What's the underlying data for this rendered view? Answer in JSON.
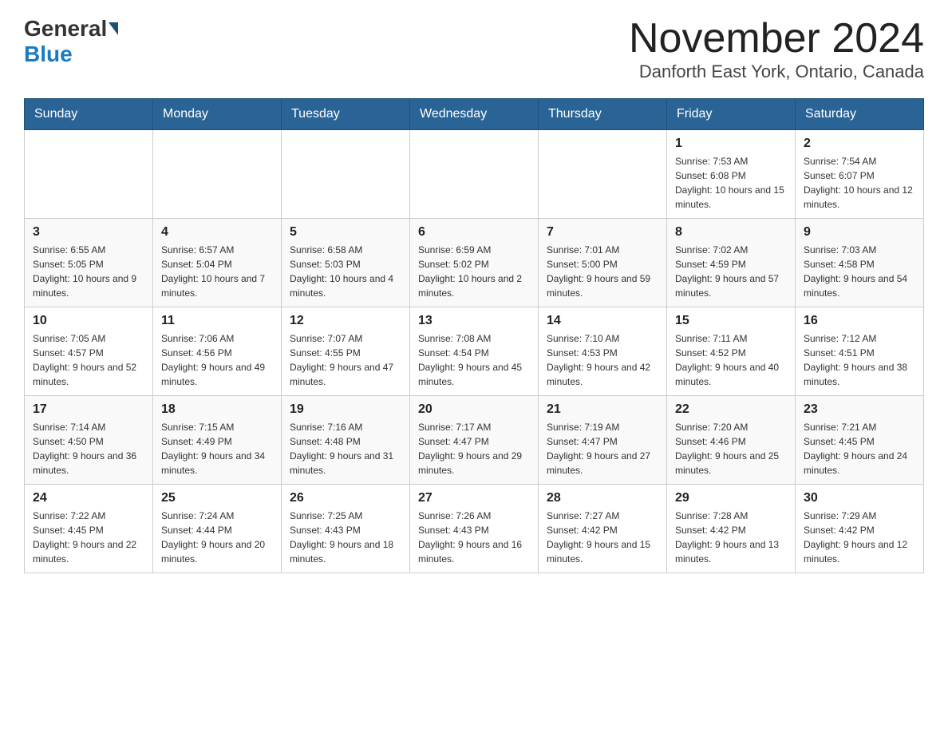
{
  "header": {
    "logo_general": "General",
    "logo_blue": "Blue",
    "month_title": "November 2024",
    "location": "Danforth East York, Ontario, Canada"
  },
  "columns": [
    "Sunday",
    "Monday",
    "Tuesday",
    "Wednesday",
    "Thursday",
    "Friday",
    "Saturday"
  ],
  "weeks": [
    {
      "days": [
        {
          "num": "",
          "info": ""
        },
        {
          "num": "",
          "info": ""
        },
        {
          "num": "",
          "info": ""
        },
        {
          "num": "",
          "info": ""
        },
        {
          "num": "",
          "info": ""
        },
        {
          "num": "1",
          "info": "Sunrise: 7:53 AM\nSunset: 6:08 PM\nDaylight: 10 hours and 15 minutes."
        },
        {
          "num": "2",
          "info": "Sunrise: 7:54 AM\nSunset: 6:07 PM\nDaylight: 10 hours and 12 minutes."
        }
      ]
    },
    {
      "days": [
        {
          "num": "3",
          "info": "Sunrise: 6:55 AM\nSunset: 5:05 PM\nDaylight: 10 hours and 9 minutes."
        },
        {
          "num": "4",
          "info": "Sunrise: 6:57 AM\nSunset: 5:04 PM\nDaylight: 10 hours and 7 minutes."
        },
        {
          "num": "5",
          "info": "Sunrise: 6:58 AM\nSunset: 5:03 PM\nDaylight: 10 hours and 4 minutes."
        },
        {
          "num": "6",
          "info": "Sunrise: 6:59 AM\nSunset: 5:02 PM\nDaylight: 10 hours and 2 minutes."
        },
        {
          "num": "7",
          "info": "Sunrise: 7:01 AM\nSunset: 5:00 PM\nDaylight: 9 hours and 59 minutes."
        },
        {
          "num": "8",
          "info": "Sunrise: 7:02 AM\nSunset: 4:59 PM\nDaylight: 9 hours and 57 minutes."
        },
        {
          "num": "9",
          "info": "Sunrise: 7:03 AM\nSunset: 4:58 PM\nDaylight: 9 hours and 54 minutes."
        }
      ]
    },
    {
      "days": [
        {
          "num": "10",
          "info": "Sunrise: 7:05 AM\nSunset: 4:57 PM\nDaylight: 9 hours and 52 minutes."
        },
        {
          "num": "11",
          "info": "Sunrise: 7:06 AM\nSunset: 4:56 PM\nDaylight: 9 hours and 49 minutes."
        },
        {
          "num": "12",
          "info": "Sunrise: 7:07 AM\nSunset: 4:55 PM\nDaylight: 9 hours and 47 minutes."
        },
        {
          "num": "13",
          "info": "Sunrise: 7:08 AM\nSunset: 4:54 PM\nDaylight: 9 hours and 45 minutes."
        },
        {
          "num": "14",
          "info": "Sunrise: 7:10 AM\nSunset: 4:53 PM\nDaylight: 9 hours and 42 minutes."
        },
        {
          "num": "15",
          "info": "Sunrise: 7:11 AM\nSunset: 4:52 PM\nDaylight: 9 hours and 40 minutes."
        },
        {
          "num": "16",
          "info": "Sunrise: 7:12 AM\nSunset: 4:51 PM\nDaylight: 9 hours and 38 minutes."
        }
      ]
    },
    {
      "days": [
        {
          "num": "17",
          "info": "Sunrise: 7:14 AM\nSunset: 4:50 PM\nDaylight: 9 hours and 36 minutes."
        },
        {
          "num": "18",
          "info": "Sunrise: 7:15 AM\nSunset: 4:49 PM\nDaylight: 9 hours and 34 minutes."
        },
        {
          "num": "19",
          "info": "Sunrise: 7:16 AM\nSunset: 4:48 PM\nDaylight: 9 hours and 31 minutes."
        },
        {
          "num": "20",
          "info": "Sunrise: 7:17 AM\nSunset: 4:47 PM\nDaylight: 9 hours and 29 minutes."
        },
        {
          "num": "21",
          "info": "Sunrise: 7:19 AM\nSunset: 4:47 PM\nDaylight: 9 hours and 27 minutes."
        },
        {
          "num": "22",
          "info": "Sunrise: 7:20 AM\nSunset: 4:46 PM\nDaylight: 9 hours and 25 minutes."
        },
        {
          "num": "23",
          "info": "Sunrise: 7:21 AM\nSunset: 4:45 PM\nDaylight: 9 hours and 24 minutes."
        }
      ]
    },
    {
      "days": [
        {
          "num": "24",
          "info": "Sunrise: 7:22 AM\nSunset: 4:45 PM\nDaylight: 9 hours and 22 minutes."
        },
        {
          "num": "25",
          "info": "Sunrise: 7:24 AM\nSunset: 4:44 PM\nDaylight: 9 hours and 20 minutes."
        },
        {
          "num": "26",
          "info": "Sunrise: 7:25 AM\nSunset: 4:43 PM\nDaylight: 9 hours and 18 minutes."
        },
        {
          "num": "27",
          "info": "Sunrise: 7:26 AM\nSunset: 4:43 PM\nDaylight: 9 hours and 16 minutes."
        },
        {
          "num": "28",
          "info": "Sunrise: 7:27 AM\nSunset: 4:42 PM\nDaylight: 9 hours and 15 minutes."
        },
        {
          "num": "29",
          "info": "Sunrise: 7:28 AM\nSunset: 4:42 PM\nDaylight: 9 hours and 13 minutes."
        },
        {
          "num": "30",
          "info": "Sunrise: 7:29 AM\nSunset: 4:42 PM\nDaylight: 9 hours and 12 minutes."
        }
      ]
    }
  ]
}
